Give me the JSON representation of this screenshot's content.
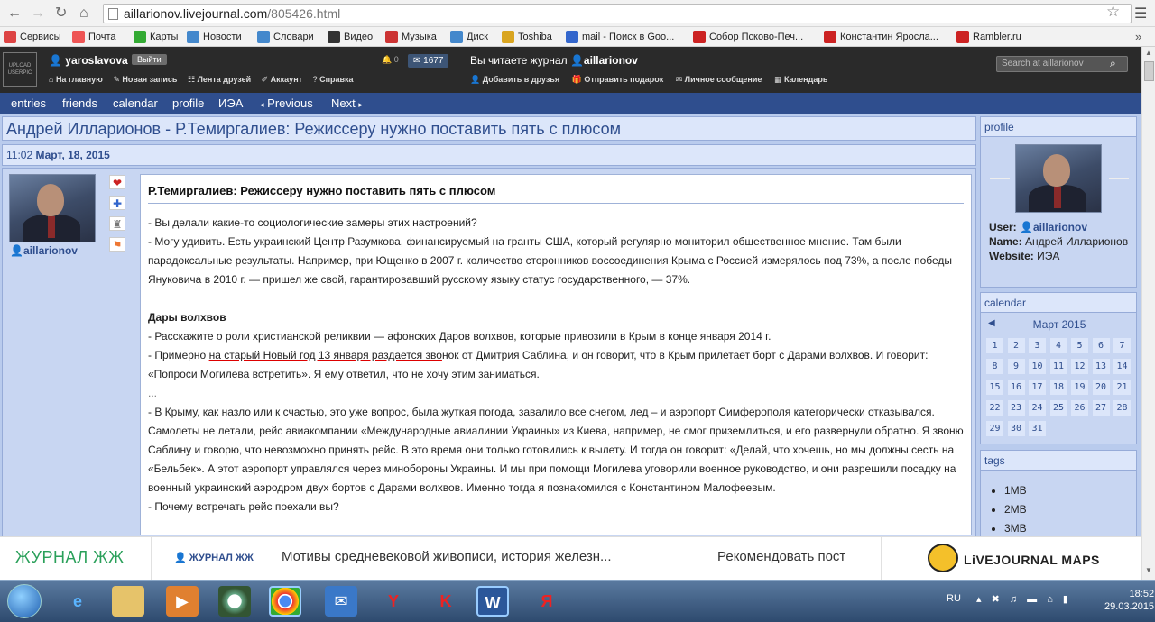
{
  "browser": {
    "url_host": "aillarionov.livejournal.com",
    "url_path": "/805426.html"
  },
  "bookmarks": [
    {
      "label": "Сервисы",
      "icon": "apps-icon",
      "color": "#d44"
    },
    {
      "label": "Почта",
      "icon": "mail-icon",
      "color": "#e55"
    },
    {
      "label": "Карты",
      "icon": "maps-icon",
      "color": "#3a3"
    },
    {
      "label": "Новости",
      "icon": "news-icon",
      "color": "#48c"
    },
    {
      "label": "Словари",
      "icon": "dict-icon",
      "color": "#48c"
    },
    {
      "label": "Видео",
      "icon": "video-icon",
      "color": "#333"
    },
    {
      "label": "Музыка",
      "icon": "music-icon",
      "color": "#c33"
    },
    {
      "label": "Диск",
      "icon": "disk-icon",
      "color": "#48c"
    },
    {
      "label": "Toshiba",
      "icon": "folder-icon",
      "color": "#d9a520"
    },
    {
      "label": "mail - Поиск в Goo...",
      "icon": "google-icon",
      "color": "#36c"
    },
    {
      "label": "Собор Псково-Печ...",
      "icon": "yandex-icon",
      "color": "#c22"
    },
    {
      "label": "Константин Яросла...",
      "icon": "yandex-icon",
      "color": "#c22"
    },
    {
      "label": "Rambler.ru",
      "icon": "yandex-icon",
      "color": "#c22"
    }
  ],
  "lj_header": {
    "upload_label": "UPLOAD USERPIC",
    "user": "yaroslavova",
    "logout": "Выйти",
    "nav": [
      "На главную",
      "Новая запись",
      "Лента друзей",
      "Аккаунт",
      "Справка"
    ],
    "counter_zero": "0",
    "counter_messages": "1677",
    "reading_prefix": "Вы читаете журнал",
    "reading_journal": "aillarionov",
    "actions": [
      "Добавить в друзья",
      "Отправить подарок",
      "Личное сообщение",
      "Календарь"
    ],
    "search_placeholder": "Search at aillarionov"
  },
  "journal_nav": {
    "items": [
      "entries",
      "friends",
      "calendar",
      "profile",
      "ИЭА"
    ],
    "previous": "Previous",
    "next": "Next"
  },
  "post": {
    "title": "Андрей Илларионов - Р.Темиргалиев: Режиссеру нужно поставить пять с плюсом",
    "time": "11:02",
    "date": "Март, 18, 2015",
    "author": "aillarionov",
    "subject": "Р.Темиргалиев: Режиссеру нужно поставить пять с плюсом",
    "q1": "- Вы делали какие-то социологические замеры этих настроений?",
    "a1": "- Могу удивить. Есть украинский Центр Разумкова, финансируемый на гранты США, который регулярно мониторил общественное мнение. Там были парадоксальные результаты. Например, при Ющенко в 2007 г. количество сторонников воссоединения Крыма с Россией измерялось под 73%, а после победы Януковича в 2010 г. — пришел же свой, гарантировавший русскому языку статус государственного, — 37%.",
    "section_title": "Дары волхвов",
    "q2": "- Расскажите о роли христианской реликвии — афонских Даров волхвов, которые привозили в Крым в конце января 2014 г.",
    "a2_pre": "- Примерно ",
    "a2_underlined": "на старый Новый год 13 января раздается зво",
    "a2_post": "нок от Дмитрия Саблина, и он говорит, что в Крым прилетает борт с Дарами волхвов. И говорит: «Попроси Могилева встретить». Я ему ответил, что не хочу этим заниматься.",
    "ellipsis": "...",
    "a3": "- В Крыму, как назло или к счастью, это уже вопрос, была жуткая погода, завалило все снегом, лед – и аэропорт Симферополя категорически отказывался. Самолеты не летали, рейс авиакомпании «Международные авиалинии Украины» из Киева, например, не смог приземлиться, и его развернули обратно. Я звоню Саблину и говорю, что невозможно принять рейс. В это время они только готовились к вылету. И тогда он говорит: «Делай, что хочешь, но мы должны сесть на «Бельбек». А этот аэропорт управлялся через минобороны Украины. И мы при помощи Могилева уговорили военное руководство, и они разрешили посадку на военный украинский аэродром двух бортов с Дарами волхвов. Именно тогда я познакомился с Константином Малофеевым.",
    "q3": "- Почему встречать рейс поехали вы?"
  },
  "sidebar": {
    "profile_header": "profile",
    "user_key": "User:",
    "user_val": "aillarionov",
    "name_key": "Name:",
    "name_val": "Андрей Илларионов",
    "website_key": "Website:",
    "website_val": "ИЭА",
    "calendar_header": "calendar",
    "calendar_month": "Март 2015",
    "calendar_days": [
      "1",
      "2",
      "3",
      "4",
      "5",
      "6",
      "7",
      "8",
      "9",
      "10",
      "11",
      "12",
      "13",
      "14",
      "15",
      "16",
      "17",
      "18",
      "19",
      "20",
      "21",
      "22",
      "23",
      "24",
      "25",
      "26",
      "27",
      "28",
      "29",
      "30",
      "31"
    ],
    "tags_header": "tags",
    "tags": [
      "1МВ",
      "2МВ",
      "3МВ"
    ]
  },
  "lj_bottom": {
    "brand": "ЖУРНАЛ ЖЖ",
    "journal_link": "ЖУРНАЛ ЖЖ",
    "teaser": "Мотивы средневековой живописи, история железн...",
    "recommend": "Рекомендовать пост",
    "maps": "LiVEJOURNAL MAPS"
  },
  "taskbar": {
    "lang": "RU",
    "time": "18:52",
    "date": "29.03.2015"
  }
}
